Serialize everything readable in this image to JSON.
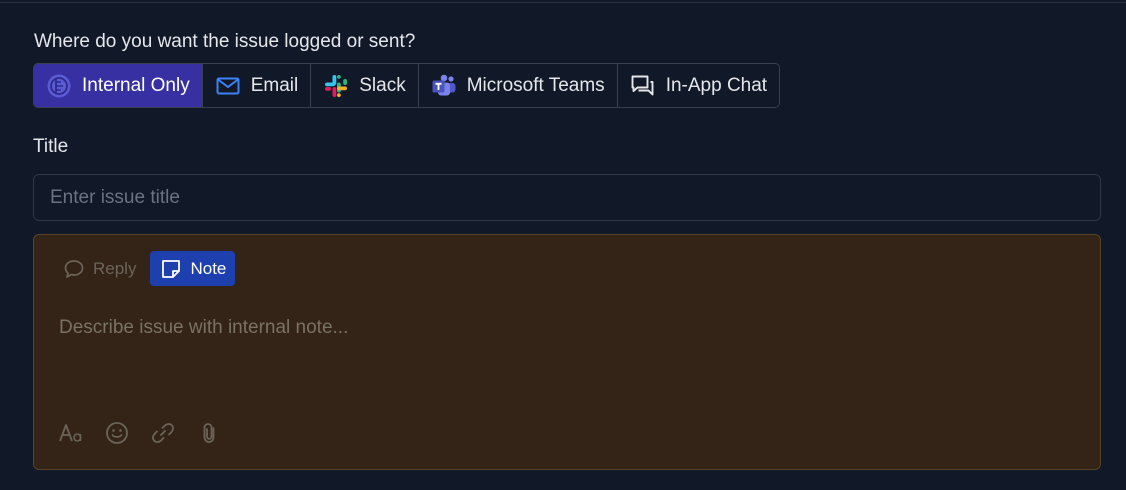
{
  "prompt": "Where do you want the issue logged or sent?",
  "channels": [
    {
      "label": "Internal Only",
      "icon": "internal-icon",
      "active": true
    },
    {
      "label": "Email",
      "icon": "mail-icon",
      "active": false
    },
    {
      "label": "Slack",
      "icon": "slack-icon",
      "active": false
    },
    {
      "label": "Microsoft Teams",
      "icon": "teams-icon",
      "active": false
    },
    {
      "label": "In-App Chat",
      "icon": "chat-icon",
      "active": false
    }
  ],
  "title_field": {
    "label": "Title",
    "placeholder": "Enter issue title",
    "value": ""
  },
  "editor": {
    "tabs": [
      {
        "label": "Reply",
        "icon": "speech-bubble-icon",
        "active": false
      },
      {
        "label": "Note",
        "icon": "sticky-note-icon",
        "active": true
      }
    ],
    "placeholder": "Describe issue with internal note...",
    "value": "",
    "tools": [
      "text-format-icon",
      "emoji-icon",
      "link-icon",
      "attachment-icon"
    ]
  },
  "colors": {
    "background": "#111827",
    "active_channel": "#3730a3",
    "note_tab": "#1e40af",
    "note_background": "#332417"
  }
}
